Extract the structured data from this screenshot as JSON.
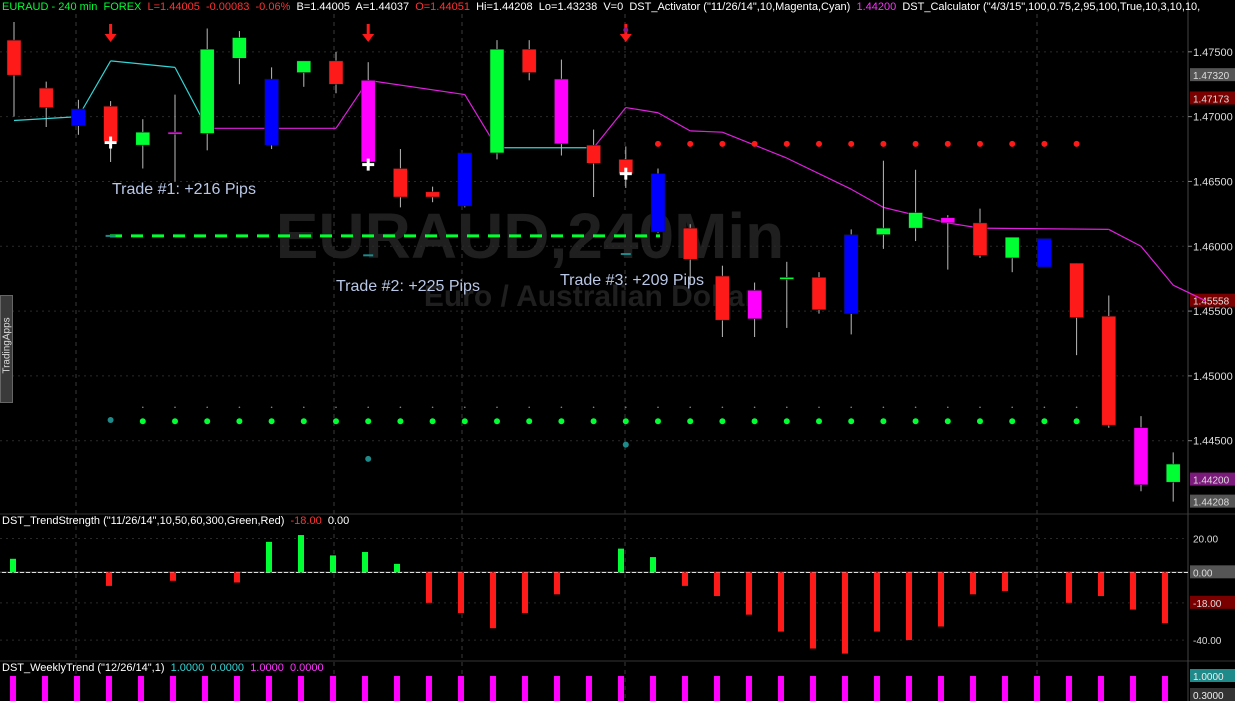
{
  "header": {
    "symbol": "EURAUD - 240 min",
    "exchange": "FOREX",
    "low": "L=1.44005",
    "change": "-0.00083",
    "change_pct": "-0.06%",
    "bid": "B=1.44005",
    "ask": "A=1.44037",
    "open": "O=1.44051",
    "high": "Hi=1.44208",
    "lo": "Lo=1.43238",
    "volume": "V=0",
    "activator": "DST_Activator (\"11/26/14\",10,Magenta,Cyan)",
    "activator_value": "1.44200",
    "calculator": "DST_Calculator (\"4/3/15\",100,0.75,2,95,100,True,10,3,10,10,"
  },
  "watermark": {
    "symbol": "EURAUD,240Min",
    "name": "Euro / Australian Dollar"
  },
  "side_tab": "TradingApps",
  "trend_strength_header": {
    "label": "DST_TrendStrength (\"11/26/14\",10,50,60,300,Green,Red)",
    "v1": "-18.00",
    "v2": "0.00"
  },
  "weekly_trend_header": {
    "label": "DST_WeeklyTrend (\"12/26/14\",1)",
    "v1": "1.0000",
    "v2": "0.0000",
    "v3": "1.0000",
    "v4": "0.0000"
  },
  "annotations": [
    "Trade #1:  +216 Pips",
    "Trade #2:  +225 Pips",
    "Trade #3:  +209 Pips"
  ],
  "colors": {
    "up": "#00ff33",
    "down": "#ff1a1a",
    "magenta": "#ff00ff",
    "blue": "#0000ff",
    "cyan": "#33d6d6",
    "activator_magenta": "#e020e0",
    "bg": "#000000",
    "grid": "#2a2a2a"
  },
  "chart_data": [
    {
      "type": "candlestick",
      "title": "EURAUD,240Min",
      "ylim": [
        1.4395,
        1.4773
      ],
      "y_ticks": [
        "1.47500",
        "1.47000",
        "1.46500",
        "1.46000",
        "1.45500",
        "1.45000",
        "1.44500"
      ],
      "price_labels": [
        {
          "text": "1.47320",
          "value": 1.4732,
          "color": "#555555"
        },
        {
          "text": "1.47173",
          "value": 1.4714,
          "color": "#7a0000"
        },
        {
          "text": "1.45558",
          "value": 1.4558,
          "color": "#7a0000"
        },
        {
          "text": "1.44200",
          "value": 1.442,
          "color": "#7a1a7a"
        },
        {
          "text": "1.44208",
          "value": 1.4403,
          "color": "#555555"
        }
      ],
      "candles": [
        {
          "o": 1.4759,
          "h": 1.4773,
          "l": 1.47,
          "c": 1.4732,
          "color": "red"
        },
        {
          "o": 1.4722,
          "h": 1.4727,
          "l": 1.4692,
          "c": 1.4707,
          "color": "red"
        },
        {
          "o": 1.4693,
          "h": 1.4713,
          "l": 1.4686,
          "c": 1.4706,
          "color": "blue"
        },
        {
          "o": 1.4708,
          "h": 1.4712,
          "l": 1.4665,
          "c": 1.4681,
          "color": "red"
        },
        {
          "o": 1.4678,
          "h": 1.4698,
          "l": 1.466,
          "c": 1.4688,
          "color": "green"
        },
        {
          "o": 1.4688,
          "h": 1.4717,
          "l": 1.465,
          "c": 1.4688,
          "color": "magenta"
        },
        {
          "o": 1.4687,
          "h": 1.4768,
          "l": 1.4674,
          "c": 1.4752,
          "color": "green"
        },
        {
          "o": 1.4745,
          "h": 1.4766,
          "l": 1.4725,
          "c": 1.4761,
          "color": "green"
        },
        {
          "o": 1.4678,
          "h": 1.4738,
          "l": 1.4675,
          "c": 1.4729,
          "color": "blue"
        },
        {
          "o": 1.4734,
          "h": 1.4743,
          "l": 1.4723,
          "c": 1.4743,
          "color": "green"
        },
        {
          "o": 1.4743,
          "h": 1.475,
          "l": 1.4718,
          "c": 1.4725,
          "color": "red"
        },
        {
          "o": 1.4728,
          "h": 1.4742,
          "l": 1.466,
          "c": 1.4665,
          "color": "magenta"
        },
        {
          "o": 1.466,
          "h": 1.4675,
          "l": 1.463,
          "c": 1.4638,
          "color": "red"
        },
        {
          "o": 1.4642,
          "h": 1.4646,
          "l": 1.4634,
          "c": 1.4638,
          "color": "red"
        },
        {
          "o": 1.4631,
          "h": 1.4672,
          "l": 1.463,
          "c": 1.4672,
          "color": "blue"
        },
        {
          "o": 1.4672,
          "h": 1.4759,
          "l": 1.4667,
          "c": 1.4752,
          "color": "green"
        },
        {
          "o": 1.4752,
          "h": 1.4759,
          "l": 1.4728,
          "c": 1.4734,
          "color": "red"
        },
        {
          "o": 1.4729,
          "h": 1.4744,
          "l": 1.467,
          "c": 1.4679,
          "color": "magenta"
        },
        {
          "o": 1.4678,
          "h": 1.469,
          "l": 1.4638,
          "c": 1.4664,
          "color": "red"
        },
        {
          "o": 1.4667,
          "h": 1.4677,
          "l": 1.4645,
          "c": 1.4656,
          "color": "red"
        },
        {
          "o": 1.4656,
          "h": 1.466,
          "l": 1.461,
          "c": 1.4611,
          "color": "blue"
        },
        {
          "o": 1.4614,
          "h": 1.4617,
          "l": 1.457,
          "c": 1.459,
          "color": "red"
        },
        {
          "o": 1.4577,
          "h": 1.4585,
          "l": 1.453,
          "c": 1.4543,
          "color": "red"
        },
        {
          "o": 1.4566,
          "h": 1.4572,
          "l": 1.453,
          "c": 1.4544,
          "color": "magenta"
        },
        {
          "o": 1.4576,
          "h": 1.4588,
          "l": 1.4537,
          "c": 1.4576,
          "color": "green"
        },
        {
          "o": 1.4576,
          "h": 1.458,
          "l": 1.4548,
          "c": 1.4551,
          "color": "red"
        },
        {
          "o": 1.4548,
          "h": 1.4613,
          "l": 1.4532,
          "c": 1.4609,
          "color": "blue"
        },
        {
          "o": 1.4609,
          "h": 1.4666,
          "l": 1.4598,
          "c": 1.4614,
          "color": "green"
        },
        {
          "o": 1.4614,
          "h": 1.4659,
          "l": 1.4604,
          "c": 1.4626,
          "color": "green"
        },
        {
          "o": 1.4622,
          "h": 1.4624,
          "l": 1.4582,
          "c": 1.4618,
          "color": "magenta"
        },
        {
          "o": 1.4618,
          "h": 1.4629,
          "l": 1.4591,
          "c": 1.4593,
          "color": "red"
        },
        {
          "o": 1.4591,
          "h": 1.4607,
          "l": 1.458,
          "c": 1.4607,
          "color": "green"
        },
        {
          "o": 1.4584,
          "h": 1.4606,
          "l": 1.4584,
          "c": 1.4606,
          "color": "blue"
        },
        {
          "o": 1.4587,
          "h": 1.4587,
          "l": 1.4516,
          "c": 1.4545,
          "color": "red"
        },
        {
          "o": 1.4546,
          "h": 1.4562,
          "l": 1.446,
          "c": 1.4462,
          "color": "red"
        },
        {
          "o": 1.446,
          "h": 1.4469,
          "l": 1.4411,
          "c": 1.4416,
          "color": "magenta"
        },
        {
          "o": 1.4418,
          "h": 1.4441,
          "l": 1.4403,
          "c": 1.4432,
          "color": "green"
        }
      ],
      "activator_line": [
        {
          "i": 0,
          "v": 1.4697
        },
        {
          "i": 2,
          "v": 1.47
        },
        {
          "i": 3,
          "v": 1.4743
        },
        {
          "i": 5,
          "v": 1.4738
        },
        {
          "i": 6,
          "v": 1.4691
        },
        {
          "i": 10,
          "v": 1.4691,
          "to_magenta": true
        },
        {
          "i": 11,
          "v": 1.4728
        },
        {
          "i": 14,
          "v": 1.4717
        },
        {
          "i": 15,
          "v": 1.4676
        },
        {
          "i": 18,
          "v": 1.4676
        },
        {
          "i": 19,
          "v": 1.4707
        },
        {
          "i": 20,
          "v": 1.4703
        },
        {
          "i": 21,
          "v": 1.4689
        },
        {
          "i": 22,
          "v": 1.4688
        },
        {
          "i": 24,
          "v": 1.4668
        },
        {
          "i": 26,
          "v": 1.4644
        },
        {
          "i": 27,
          "v": 1.463
        },
        {
          "i": 29,
          "v": 1.4618
        },
        {
          "i": 30,
          "v": 1.4614
        },
        {
          "i": 34,
          "v": 1.4613
        },
        {
          "i": 35,
          "v": 1.46
        },
        {
          "i": 36,
          "v": 1.457
        },
        {
          "i": 37,
          "v": 1.4558
        }
      ],
      "cyan_segments": [
        [
          0,
          6
        ],
        [
          15,
          18
        ]
      ],
      "sell_arrows": [
        3,
        11,
        19
      ],
      "entry_crosses": [
        {
          "i": 3,
          "v": 1.468
        },
        {
          "i": 11,
          "v": 1.4663
        },
        {
          "i": 19,
          "v": 1.4656
        }
      ],
      "red_dot_row": {
        "value": 1.4679,
        "from": 20,
        "to": 33
      },
      "green_dot_row": {
        "value": 1.4465,
        "from": 4,
        "to": 33
      },
      "teal_dots": [
        {
          "i": 3,
          "v": 1.4466
        },
        {
          "i": 11,
          "v": 1.4436
        },
        {
          "i": 19,
          "v": 1.4447
        }
      ],
      "teal_dashes": [
        {
          "i": 3,
          "v": 1.4608
        },
        {
          "i": 11,
          "v": 1.4593
        },
        {
          "i": 19,
          "v": 1.4594
        }
      ],
      "target_level": 1.4608
    },
    {
      "type": "bar",
      "title": "DST_TrendStrength",
      "ylim": [
        -50,
        25
      ],
      "y_ticks": [
        "20.00",
        "0.00",
        "-18.00",
        "-40.00"
      ],
      "values": [
        8,
        0,
        0,
        -8,
        0,
        -5,
        0,
        -6,
        18,
        22,
        10,
        12,
        5,
        -18,
        -24,
        -33,
        -24,
        -13,
        0,
        14,
        9,
        -8,
        -14,
        -25,
        -35,
        -45,
        -48,
        -35,
        -40,
        -32,
        -13,
        -11,
        0,
        -18,
        -14,
        -22,
        -30,
        -35,
        -55,
        -60,
        -55
      ]
    },
    {
      "type": "bar",
      "title": "DST_WeeklyTrend",
      "ylim": [
        0,
        1
      ],
      "y_ticks": [
        "1.0000",
        "0.3000"
      ],
      "values": [
        1,
        1,
        1,
        1,
        1,
        1,
        1,
        1,
        1,
        1,
        1,
        1,
        1,
        1,
        1,
        1,
        1,
        1,
        1,
        1,
        1,
        1,
        1,
        1,
        1,
        1,
        1,
        1,
        1,
        1,
        1,
        1,
        1,
        1,
        1,
        1,
        1
      ]
    }
  ]
}
